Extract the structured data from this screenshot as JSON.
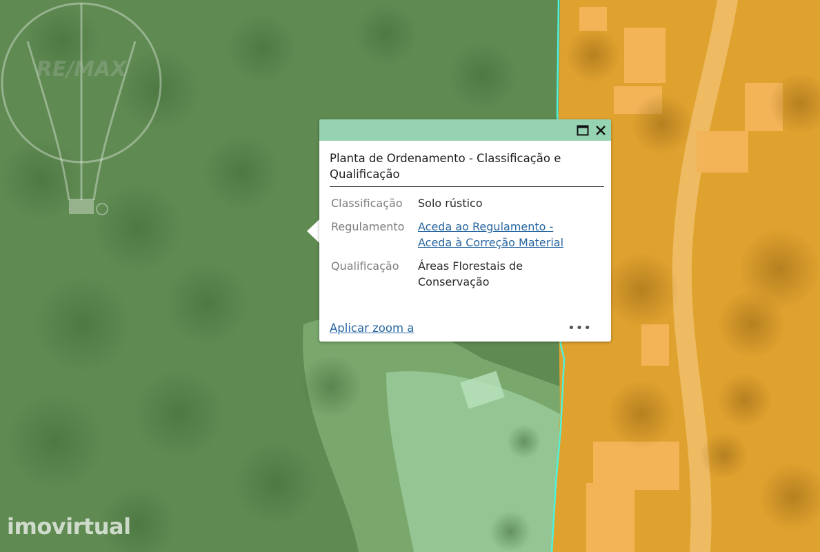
{
  "map": {
    "layers": {
      "left_zone_color": "#5f8a52",
      "right_zone_color": "#e0a22f",
      "boundary_color": "#4ef2dd",
      "highlight_color": "#9fd2a2"
    }
  },
  "popup": {
    "title": "Planta de Ordenamento - Classificação e Qualificação",
    "header_color": "#96d3b2",
    "attributes": [
      {
        "key": "Classificação",
        "value": "Solo rústico"
      },
      {
        "key": "Regulamento",
        "links": [
          "Aceda ao Regulamento -",
          "Aceda à Correção Material"
        ]
      },
      {
        "key": "Qualificação",
        "value": "Áreas Florestais de Conservação"
      }
    ],
    "zoom_label": "Aplicar zoom a",
    "more_label": "•••",
    "icons": {
      "maximize": "maximize-icon",
      "close": "close-icon"
    }
  },
  "watermarks": {
    "brand": "imovirtual",
    "balloon_text": "RE/MAX"
  }
}
